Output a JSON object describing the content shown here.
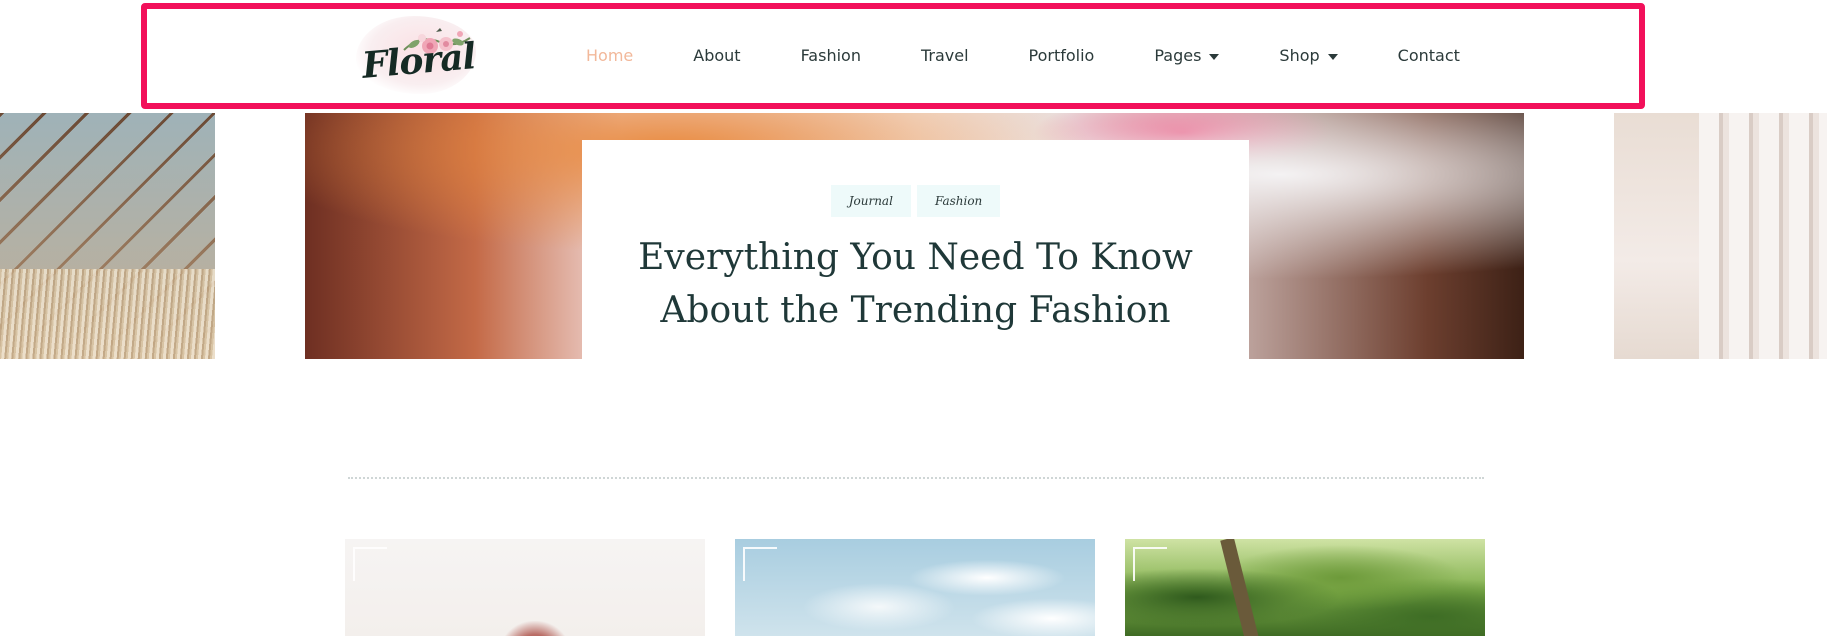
{
  "header": {
    "logo_text": "Floral",
    "nav": [
      {
        "label": "Home",
        "active": true
      },
      {
        "label": "About"
      },
      {
        "label": "Fashion"
      },
      {
        "label": "Travel"
      },
      {
        "label": "Portfolio"
      },
      {
        "label": "Pages",
        "has_dropdown": true
      },
      {
        "label": "Shop",
        "has_dropdown": true
      },
      {
        "label": "Contact"
      }
    ]
  },
  "hero": {
    "tags": [
      "Journal",
      "Fashion"
    ],
    "title": "Everything You Need To Know About the Trending Fashion"
  },
  "colors": {
    "accent_active_nav": "#f2b89a",
    "highlight_frame": "#f2105a",
    "tag_background": "#eefafa",
    "heading_text": "#1f3838"
  },
  "icons": {
    "dropdown": "chevron-down-icon"
  }
}
